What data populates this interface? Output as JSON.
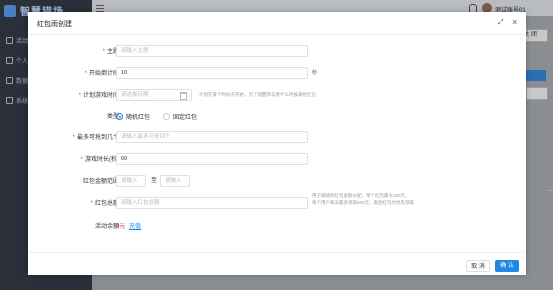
{
  "app": {
    "logo_text": "智慧猎场",
    "user_name": "测试账号01",
    "bg_button": "关 闭"
  },
  "sidebar": {
    "items": [
      {
        "label": "活动列表"
      },
      {
        "label": "个人中心"
      },
      {
        "label": "数据统计"
      },
      {
        "label": "系统设置"
      }
    ]
  },
  "modal": {
    "title": "红包雨创建",
    "fields": {
      "subject": {
        "label": "主题",
        "placeholder": "请输入主题"
      },
      "countdown": {
        "label": "开始倒计时",
        "value": "10",
        "suffix": "秒"
      },
      "planned_time": {
        "label": "计划游戏时间",
        "placeholder": "请选择日期",
        "hint": "计划在某个时间点开始，为了提醒参与者什么时候来抢红包"
      },
      "type": {
        "label": "类型",
        "options": [
          "随机红包",
          "固定红包"
        ],
        "selected": "随机红包"
      },
      "max_grab": {
        "label": "最多可抢到几个",
        "placeholder": "请输入最多可抢到个"
      },
      "duration": {
        "label": "游戏时长(秒)",
        "value": "60"
      },
      "amount_range": {
        "label": "红包金额范围",
        "min_placeholder": "请输入",
        "separator": "至",
        "max_placeholder": "请输入"
      },
      "total": {
        "label": "红包总额",
        "placeholder": "请输入红包总额",
        "hint_line1": "用于随随机红包金额分配，单个红包最大200元，",
        "hint_line2": "每个用户每天最多领取200元，发放红包时优先领取"
      },
      "balance": {
        "label": "活动余额",
        "value": "0元",
        "link": "充值"
      }
    },
    "footer": {
      "cancel": "取 消",
      "ok": "确 认"
    }
  },
  "colors": {
    "accent": "#1e88e5",
    "required": "#e04b4b",
    "sidebar_bg": "#2b2f3a"
  }
}
